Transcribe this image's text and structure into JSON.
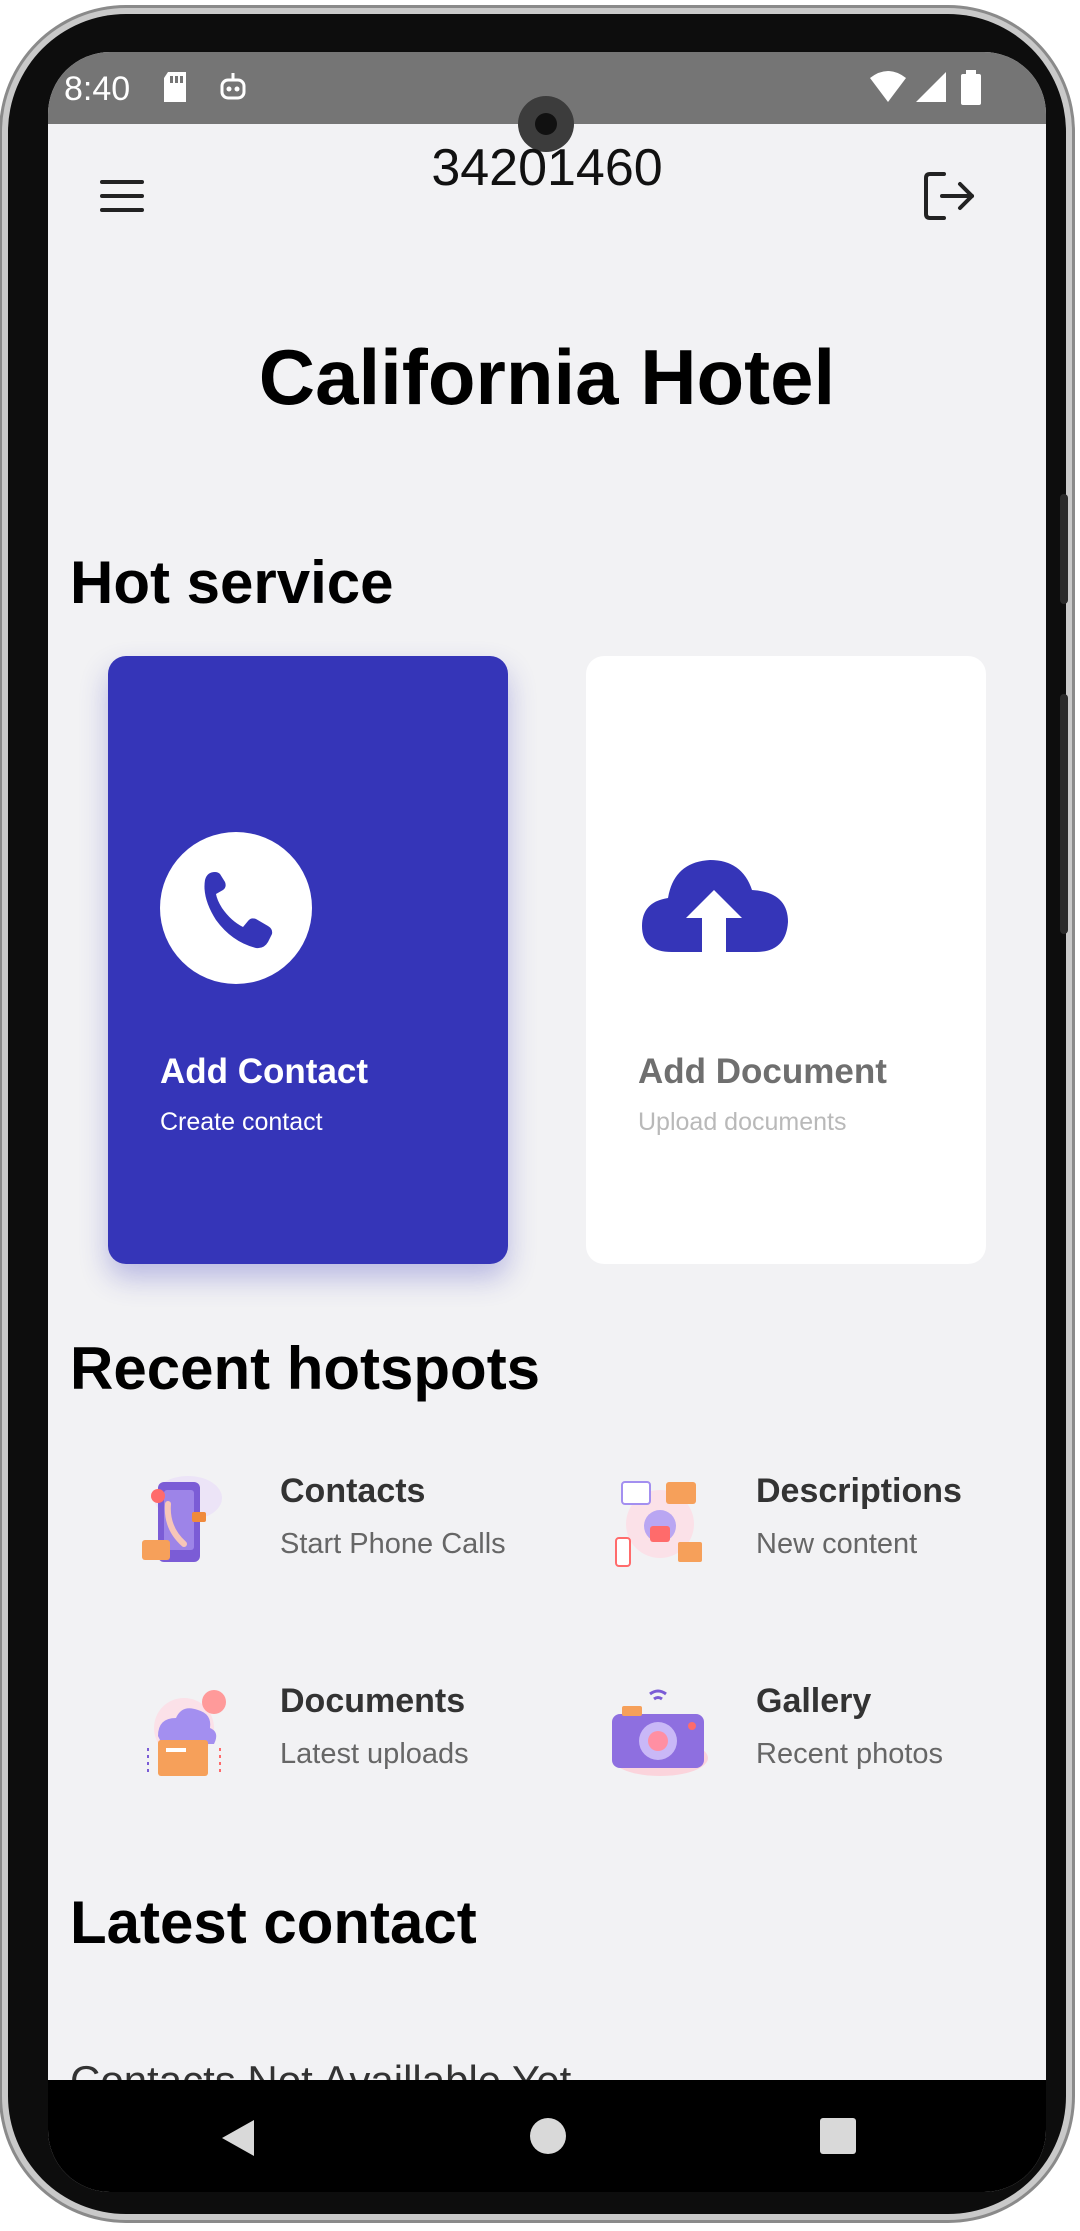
{
  "status_bar": {
    "time": "8:40"
  },
  "app_bar": {
    "title": "34201460"
  },
  "hotel": {
    "name": "California Hotel"
  },
  "sections": {
    "hot_service": "Hot service",
    "recent_hotspots": "Recent hotspots",
    "latest_contact": "Latest contact"
  },
  "hot_service": [
    {
      "label": "Add Contact",
      "sublabel": "Create contact",
      "icon": "phone-icon"
    },
    {
      "label": "Add Document",
      "sublabel": "Upload documents",
      "icon": "cloud-upload-icon"
    }
  ],
  "hotspots": [
    {
      "title": "Contacts",
      "subtitle": "Start Phone Calls",
      "icon": "contacts-illustration-icon"
    },
    {
      "title": "Descriptions",
      "subtitle": "New content",
      "icon": "descriptions-illustration-icon"
    },
    {
      "title": "Documents",
      "subtitle": "Latest uploads",
      "icon": "documents-illustration-icon"
    },
    {
      "title": "Gallery",
      "subtitle": "Recent photos",
      "icon": "gallery-illustration-icon"
    }
  ],
  "latest_contact": {
    "partial_text": "Contacts Not Availlable Yet"
  },
  "colors": {
    "primary": "#3535b8",
    "background": "#f2f2f4",
    "statusbar": "#757575"
  }
}
